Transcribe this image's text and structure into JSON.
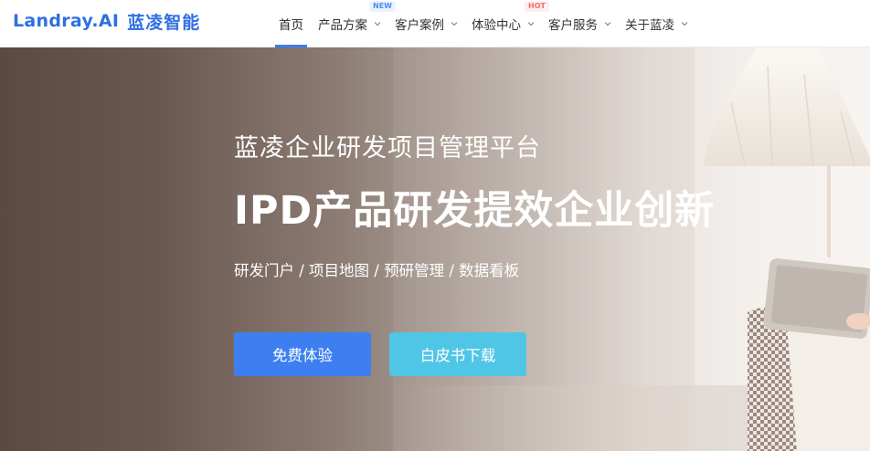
{
  "brand": {
    "logo_en": "Landray.AI",
    "logo_cn": "蓝凌智能",
    "color": "#2f6fe4"
  },
  "nav": {
    "items": [
      {
        "label": "首页",
        "active": true
      },
      {
        "label": "产品方案",
        "badge": "NEW"
      },
      {
        "label": "客户案例"
      },
      {
        "label": "体验中心",
        "badge": "HOT"
      },
      {
        "label": "客户服务"
      },
      {
        "label": "关于蓝凌"
      }
    ],
    "accent": "#3d7cf2"
  },
  "hero": {
    "subtitle": "蓝凌企业研发项目管理平台",
    "title": "IPD产品研发提效企业创新",
    "features": "研发门户 / 项目地图 / 预研管理 / 数据看板",
    "primary_button": "免费体验",
    "secondary_button": "白皮书下载",
    "primary_color": "#3d7ff0",
    "secondary_color": "#4fc6e6"
  }
}
